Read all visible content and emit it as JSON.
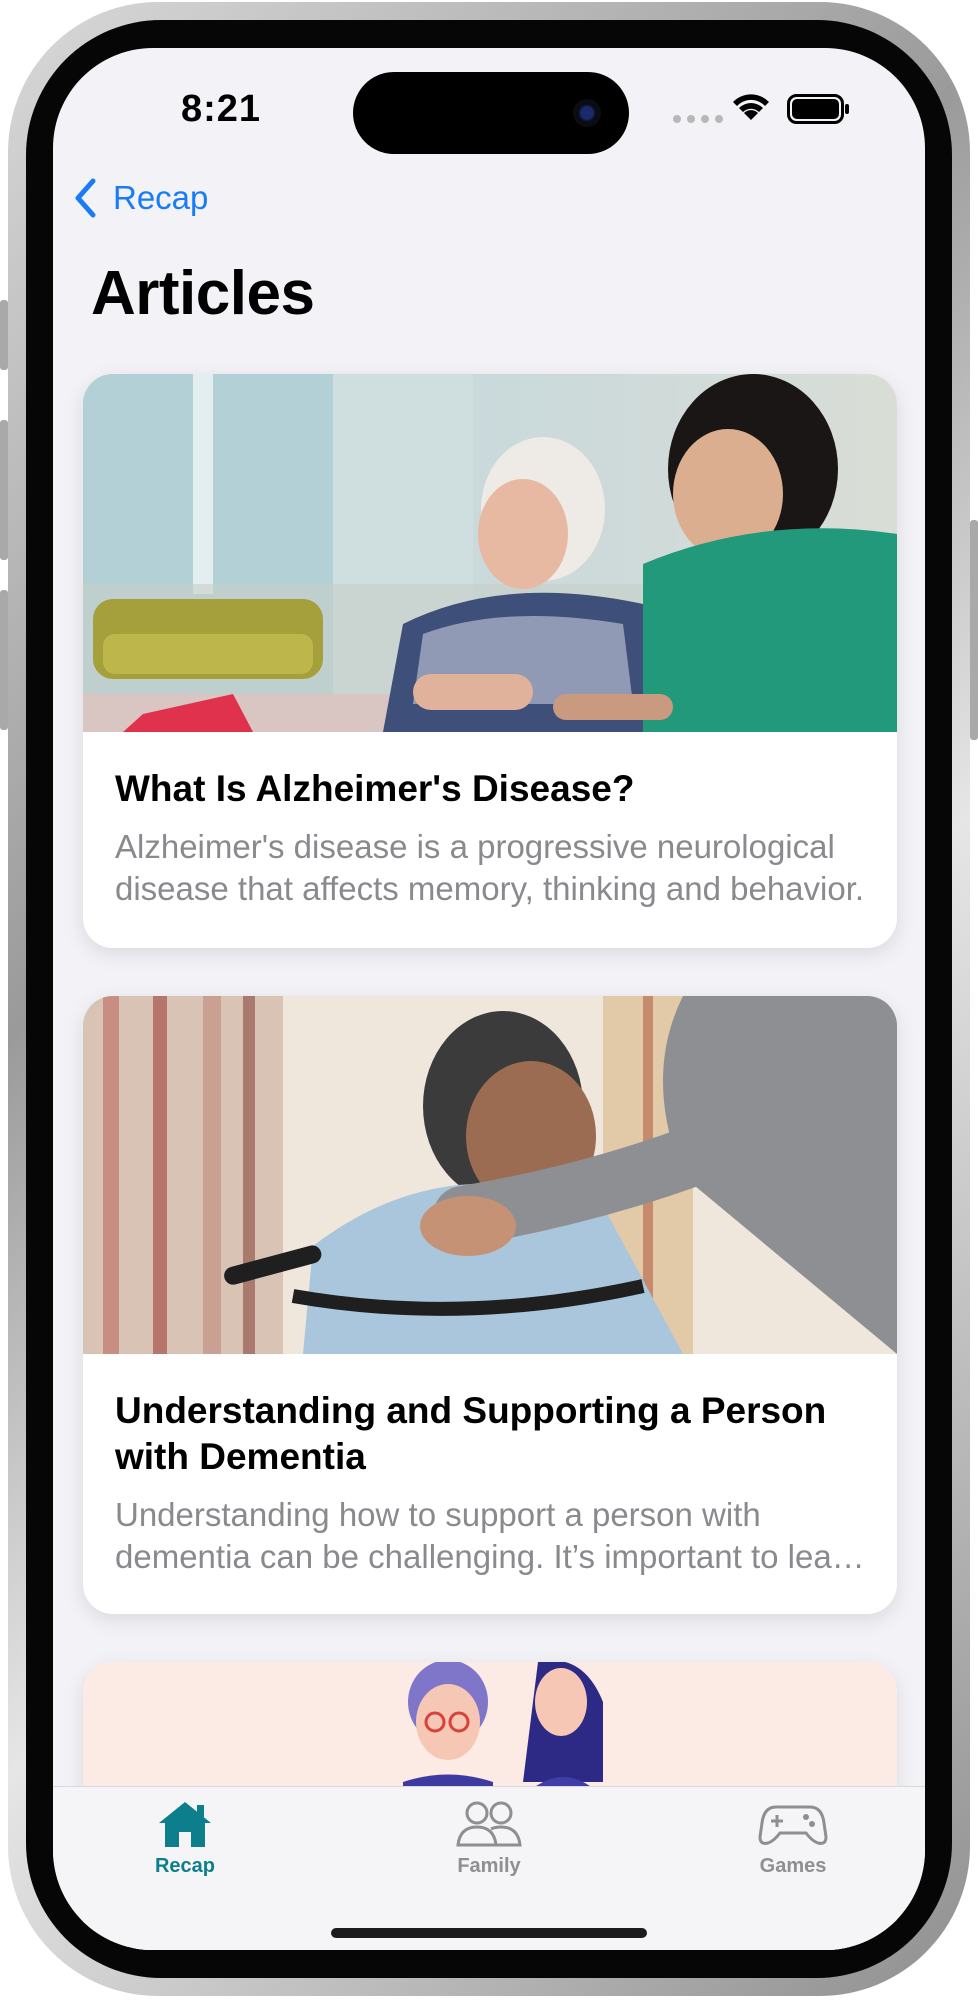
{
  "status_bar": {
    "time": "8:21"
  },
  "nav": {
    "back_label": "Recap"
  },
  "page": {
    "title": "Articles"
  },
  "articles": [
    {
      "title": "What Is Alzheimer's Disease?",
      "description": "Alzheimer's disease is a progressive neurological disease that affects memory, thinking and behavior."
    },
    {
      "title": "Understanding and Supporting a Person with Dementia",
      "description": "Understanding how to support a person with dementia can be challenging. It’s important to learn about the condition."
    },
    {
      "title": "",
      "description": ""
    }
  ],
  "tab_bar": {
    "tabs": [
      {
        "label": "Recap",
        "icon": "house-icon",
        "selected": true
      },
      {
        "label": "Family",
        "icon": "people-icon",
        "selected": false
      },
      {
        "label": "Games",
        "icon": "gamecontroller-icon",
        "selected": false
      }
    ]
  },
  "colors": {
    "accent": "#1a7cf5",
    "tab_selected": "#0d7f8c",
    "tab_unselected": "#8e8e93",
    "background": "#f2f2f7"
  }
}
